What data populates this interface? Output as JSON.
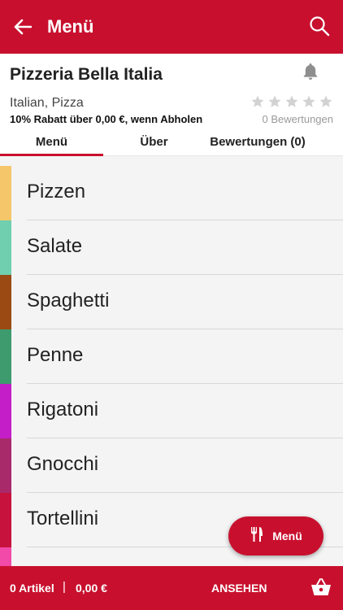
{
  "header": {
    "title": "Menü",
    "back_icon": "arrow-left-icon",
    "search_icon": "search-icon"
  },
  "restaurant": {
    "name": "Pizzeria Bella Italia",
    "cuisine": "Italian, Pizza",
    "discount": "10% Rabatt über 0,00 €, wenn Abholen",
    "rating_stars": 0,
    "max_stars": 5,
    "ratings_count": "0 Bewertungen",
    "bell_icon": "bell-icon"
  },
  "tabs": [
    {
      "label": "Menü",
      "active": true
    },
    {
      "label": "Über",
      "active": false
    },
    {
      "label": "Bewertungen (0)",
      "active": false
    }
  ],
  "categories": [
    {
      "label": "Pizzen",
      "color": "#f5c76a"
    },
    {
      "label": "Salate",
      "color": "#6fcfae"
    },
    {
      "label": "Spaghetti",
      "color": "#9a4a12"
    },
    {
      "label": "Penne",
      "color": "#3e9b6e"
    },
    {
      "label": "Rigatoni",
      "color": "#c41ec9"
    },
    {
      "label": "Gnocchi",
      "color": "#a82a6b"
    },
    {
      "label": "Tortellini",
      "color": "#c7123d"
    },
    {
      "label": "",
      "color": "#f24aa8"
    }
  ],
  "fab": {
    "label": "Menü",
    "icon": "fork-knife-icon"
  },
  "cart": {
    "count": "0 Artikel",
    "divider": "|",
    "total": "0,00 €",
    "view_label": "ANSEHEN",
    "basket_icon": "basket-icon"
  },
  "colors": {
    "brand": "#c8102e",
    "background": "#f4f4f5"
  }
}
